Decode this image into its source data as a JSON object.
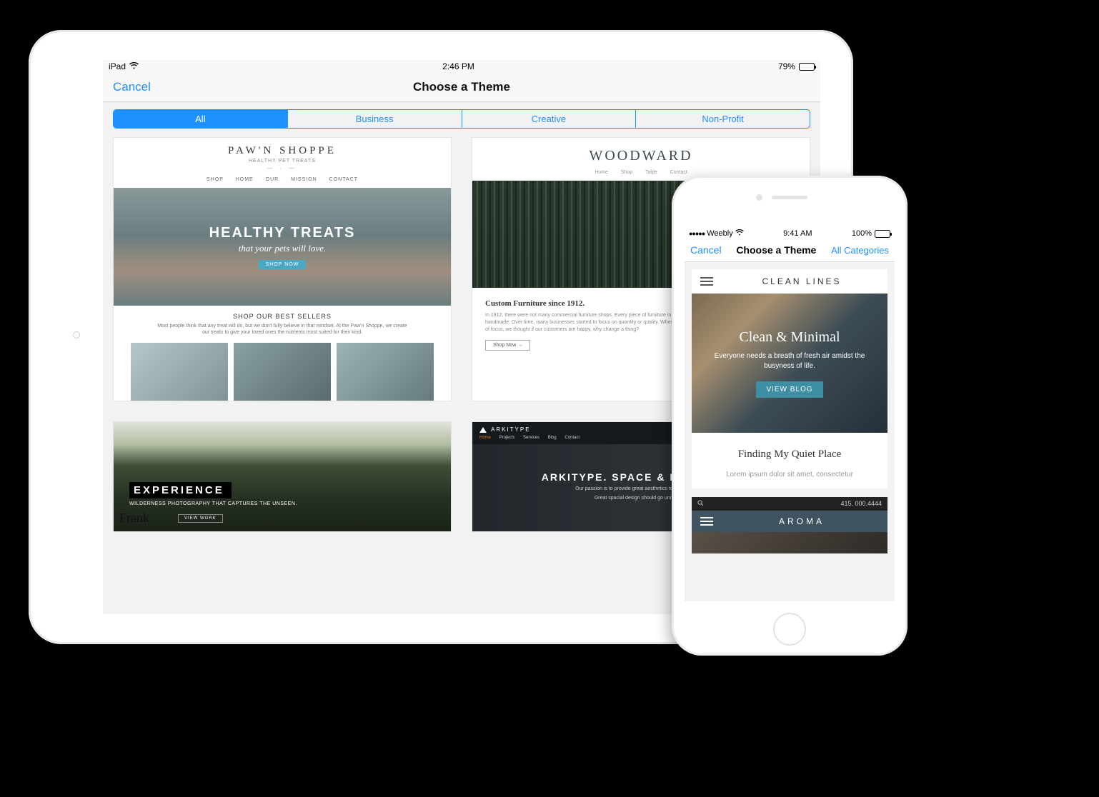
{
  "ipad": {
    "status": {
      "device": "iPad",
      "time": "2:46 PM",
      "battery_pct": "79%"
    },
    "nav": {
      "cancel": "Cancel",
      "title": "Choose a Theme"
    },
    "segments": [
      "All",
      "Business",
      "Creative",
      "Non-Profit"
    ],
    "active_segment": 0,
    "themes": {
      "pawn": {
        "logo": "PAW'N SHOPPE",
        "tagline": "HEALTHY PET TREATS",
        "nav": "SHOP   HOME   OUR MISSION   CONTACT",
        "hero_h": "HEALTHY TREATS",
        "hero_sub": "that your pets will love.",
        "hero_btn": "SHOP NOW",
        "best": "SHOP OUR BEST SELLERS",
        "blurb": "Most people think that any treat will do, but we don't fully believe in that mindset. At the Paw'n Shoppe, we create our treats to give your loved ones the nutrients most suited for their kind."
      },
      "woodward": {
        "brand": "WOODWARD",
        "nav": "Home   Shop   Table   Contact",
        "heading": "Custom Furniture since 1912.",
        "body": "In 1912, there were not many commercial furniture shops. Every piece of furniture in people's homes was handmade. Over time, many businesses started to focus on quantity or quality. When faced with this dilemma of focus, we thought if our customers are happy, why change a thing?",
        "shop": "Shop Now →"
      },
      "experience": {
        "title": "EXPERIENCE",
        "sub": "WILDERNESS PHOTOGRAPHY THAT CAPTURES THE UNSEEN.",
        "sig": "Frank",
        "view": "VIEW WORK"
      },
      "arkitype": {
        "brand": "ARKITYPE",
        "nav_home": "Home",
        "nav_rest": "Projects   Services   Blog   Contact",
        "title": "ARKITYPE. SPACE & FURNITURE",
        "body1": "Our passion is to provide great aesthetics to varied spaces.",
        "body2": "Great spacial design should go unnoticed."
      }
    }
  },
  "iphone": {
    "status": {
      "carrier": "Weebly",
      "time": "9:41 AM",
      "battery_pct": "100%"
    },
    "nav": {
      "cancel": "Cancel",
      "title": "Choose a Theme",
      "right": "All Categories"
    },
    "clean": {
      "brand": "CLEAN LINES",
      "hero_h": "Clean & Minimal",
      "hero_p": "Everyone needs a breath of fresh air amidst the busyness of life.",
      "hero_btn": "VIEW BLOG",
      "article_h": "Finding My Quiet Place",
      "article_p": "Lorem ipsum dolor sit amet, consectetur"
    },
    "aroma": {
      "phone": "415. 000.4444",
      "brand": "AROMA"
    }
  }
}
